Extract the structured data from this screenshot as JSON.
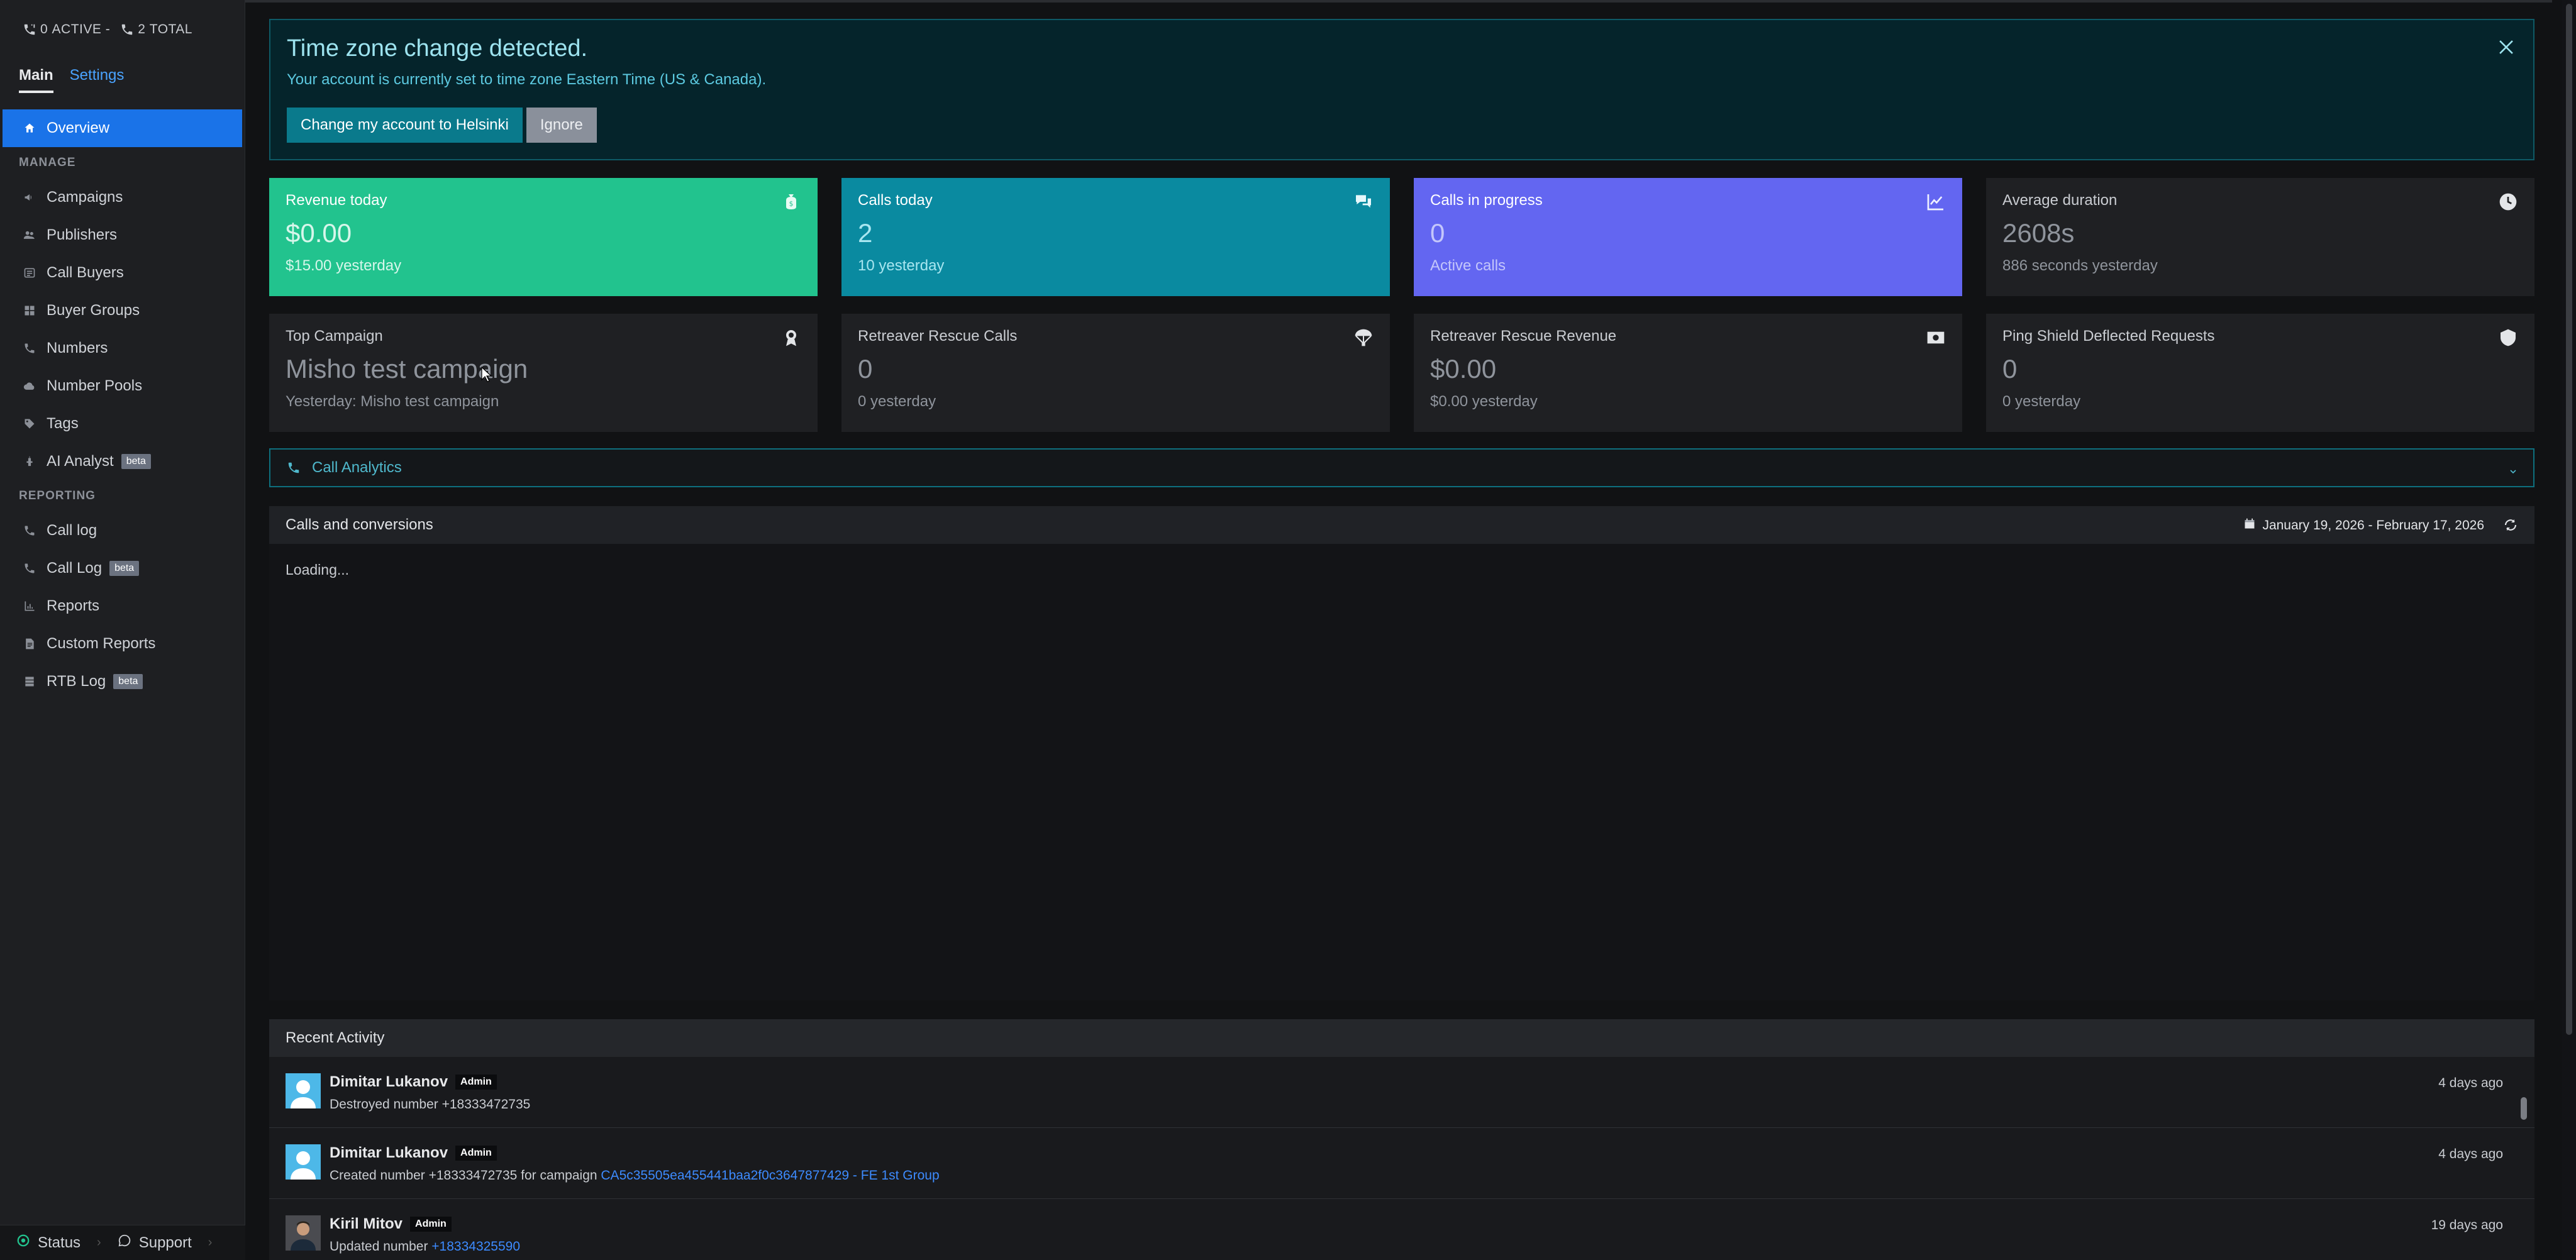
{
  "status_bar": {
    "active_count": "0",
    "active_label": "ACTIVE -",
    "total_count": "2",
    "total_label": "TOTAL"
  },
  "sidebar": {
    "tabs": [
      {
        "label": "Main"
      },
      {
        "label": "Settings"
      }
    ],
    "overview": "Overview",
    "manage_heading": "MANAGE",
    "manage_items": [
      {
        "label": "Campaigns",
        "icon": "megaphone-icon"
      },
      {
        "label": "Publishers",
        "icon": "users-icon"
      },
      {
        "label": "Call Buyers",
        "icon": "list-icon"
      },
      {
        "label": "Buyer Groups",
        "icon": "grid-icon"
      },
      {
        "label": "Numbers",
        "icon": "phone-icon"
      },
      {
        "label": "Number Pools",
        "icon": "cloud-icon"
      },
      {
        "label": "Tags",
        "icon": "tag-icon"
      },
      {
        "label": "AI Analyst",
        "icon": "robot-icon",
        "badge": "beta"
      }
    ],
    "reporting_heading": "REPORTING",
    "reporting_items": [
      {
        "label": "Call log",
        "icon": "phone-log-icon"
      },
      {
        "label": "Call Log",
        "icon": "phone-log-icon",
        "badge": "beta"
      },
      {
        "label": "Reports",
        "icon": "bar-chart-icon"
      },
      {
        "label": "Custom Reports",
        "icon": "file-icon"
      },
      {
        "label": "RTB Log",
        "icon": "database-icon",
        "badge": "beta"
      }
    ],
    "bottom": {
      "status": "Status",
      "support": "Support"
    }
  },
  "alert": {
    "title": "Time zone change detected.",
    "message": "Your account is currently set to time zone Eastern Time (US & Canada).",
    "primary_button": "Change my account to Helsinki",
    "secondary_button": "Ignore"
  },
  "cards": [
    {
      "title": "Revenue today",
      "value": "$0.00",
      "sub": "$15.00 yesterday",
      "icon": "money-bag-icon",
      "color": "#22c38e"
    },
    {
      "title": "Calls today",
      "value": "2",
      "sub": "10 yesterday",
      "icon": "chat-icon",
      "color": "#0a8aa0"
    },
    {
      "title": "Calls in progress",
      "value": "0",
      "sub": "Active calls",
      "icon": "line-chart-icon",
      "color": "#6366f1"
    },
    {
      "title": "Average duration",
      "value": "2608s",
      "sub": "886 seconds yesterday",
      "icon": "clock-icon",
      "color": "#1f2023"
    },
    {
      "title": "Top Campaign",
      "value": "Misho test campaign",
      "sub": "Yesterday: Misho test campaign",
      "icon": "award-icon"
    },
    {
      "title": "Retreaver Rescue Calls",
      "value": "0",
      "sub": "0 yesterday",
      "icon": "parachute-icon"
    },
    {
      "title": "Retreaver Rescue Revenue",
      "value": "$0.00",
      "sub": "$0.00 yesterday",
      "icon": "cash-icon"
    },
    {
      "title": "Ping Shield Deflected Requests",
      "value": "0",
      "sub": "0 yesterday",
      "icon": "shield-icon"
    }
  ],
  "analytics": {
    "label": "Call Analytics"
  },
  "calls_panel": {
    "title": "Calls and conversions",
    "date_range": "January 19, 2026 - February 17, 2026",
    "loading": "Loading..."
  },
  "activity": {
    "title": "Recent Activity",
    "items": [
      {
        "name": "Dimitar Lukanov",
        "role": "Admin",
        "text": "Destroyed number +18333472735",
        "link": "",
        "time": "4 days ago"
      },
      {
        "name": "Dimitar Lukanov",
        "role": "Admin",
        "text": "Created number +18333472735 for campaign ",
        "link": "CA5c35505ea455441baa2f0c3647877429 - FE 1st Group",
        "time": "4 days ago"
      },
      {
        "name": "Kiril Mitov",
        "role": "Admin",
        "text": "Updated number ",
        "link": "+18334325590",
        "time": "19 days ago"
      }
    ]
  }
}
